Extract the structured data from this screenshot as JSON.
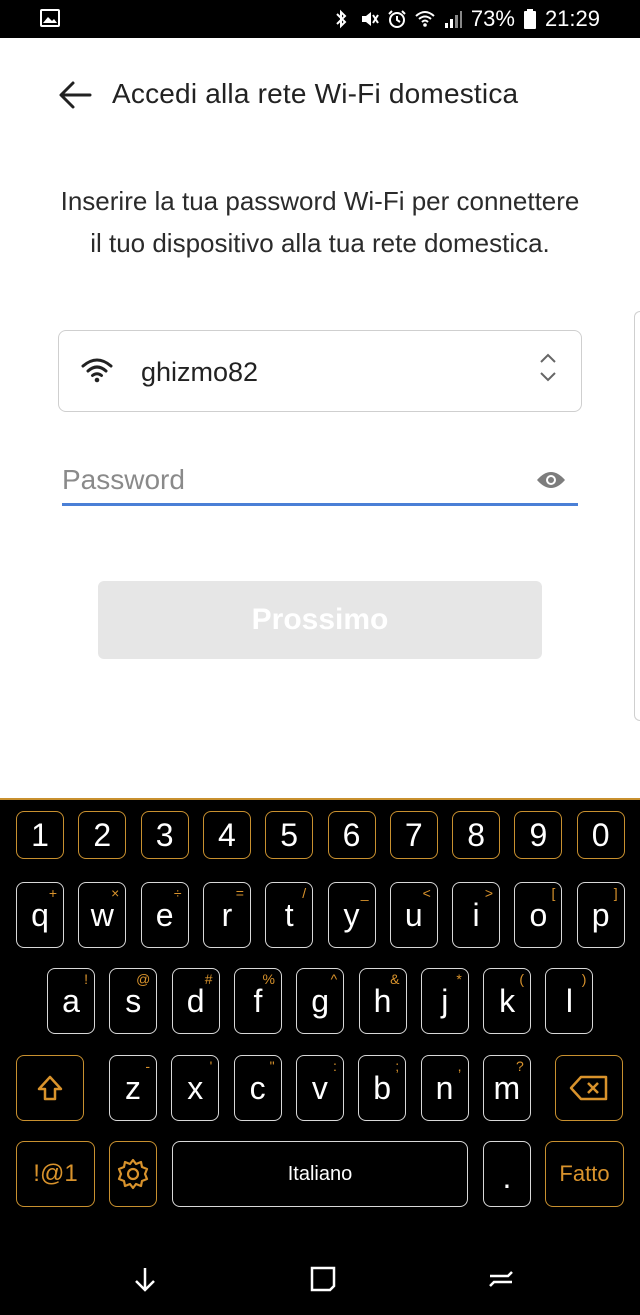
{
  "status_bar": {
    "battery": "73%",
    "time": "21:29"
  },
  "header": {
    "title": "Accedi alla rete Wi-Fi domestica"
  },
  "instructions": "Inserire la tua password Wi-Fi per connettere il tuo dispositivo alla tua rete domestica.",
  "network": {
    "ssid": "ghizmo82"
  },
  "password": {
    "placeholder": "Password",
    "value": ""
  },
  "next_button": {
    "label": "Prossimo"
  },
  "keyboard": {
    "numbers": [
      "1",
      "2",
      "3",
      "4",
      "5",
      "6",
      "7",
      "8",
      "9",
      "0"
    ],
    "row1": [
      {
        "key": "q",
        "hint": "+"
      },
      {
        "key": "w",
        "hint": "×"
      },
      {
        "key": "e",
        "hint": "÷"
      },
      {
        "key": "r",
        "hint": "="
      },
      {
        "key": "t",
        "hint": "/"
      },
      {
        "key": "y",
        "hint": "_"
      },
      {
        "key": "u",
        "hint": "<"
      },
      {
        "key": "i",
        "hint": ">"
      },
      {
        "key": "o",
        "hint": "["
      },
      {
        "key": "p",
        "hint": "]"
      }
    ],
    "row2": [
      {
        "key": "a",
        "hint": "!"
      },
      {
        "key": "s",
        "hint": "@"
      },
      {
        "key": "d",
        "hint": "#"
      },
      {
        "key": "f",
        "hint": "%"
      },
      {
        "key": "g",
        "hint": "^"
      },
      {
        "key": "h",
        "hint": "&"
      },
      {
        "key": "j",
        "hint": "*"
      },
      {
        "key": "k",
        "hint": "("
      },
      {
        "key": "l",
        "hint": ")"
      }
    ],
    "row3": [
      {
        "key": "z",
        "hint": "-"
      },
      {
        "key": "x",
        "hint": "'"
      },
      {
        "key": "c",
        "hint": "\""
      },
      {
        "key": "v",
        "hint": ":"
      },
      {
        "key": "b",
        "hint": ";"
      },
      {
        "key": "n",
        "hint": ","
      },
      {
        "key": "m",
        "hint": "?"
      }
    ],
    "symbols_label": "!@1",
    "space_label": "Italiano",
    "period_label": ".",
    "done_label": "Fatto"
  },
  "colors": {
    "accent_blue": "#4a7fd6",
    "keyboard_orange": "#d9932c",
    "button_disabled": "#e6e6e6"
  }
}
